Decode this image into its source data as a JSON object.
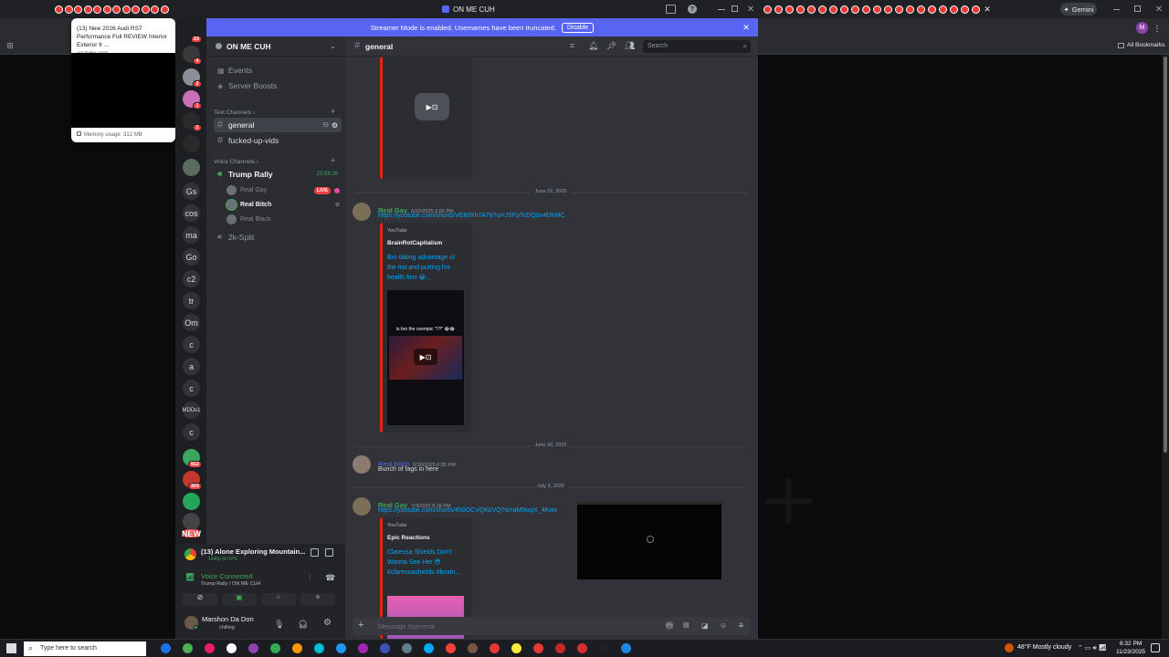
{
  "browser": {
    "window_title": "ON ME CUH",
    "gemini_label": "Gemini",
    "all_bookmarks": "All Bookmarks",
    "profile_initial": "M",
    "tab_count_left": 12,
    "tab_count_right": 20
  },
  "tooltip": {
    "title": "(13) New 2026 Audi RS7 Performance Full REVIEW Interior Exterior fr ...",
    "domain": "youtube.com",
    "memory": "Memory usage: 312 MB"
  },
  "banner": {
    "text": "Streamer Mode is enabled. Usernames have been truncated.",
    "button": "Disable"
  },
  "guilds": [
    {
      "label": "",
      "icon": "discord-home-icon",
      "badge": "23",
      "color": "#1e1f22"
    },
    {
      "label": "",
      "icon": "avatar",
      "badge": "4",
      "color": "#3a3a3a"
    },
    {
      "label": "",
      "icon": "avatar",
      "badge": "2",
      "color": "#8a8f98"
    },
    {
      "label": "",
      "icon": "avatar",
      "badge": "1",
      "color": "#c86fb5"
    },
    {
      "label": "",
      "icon": "hammers-icon",
      "badge": "1",
      "color": "#2a2a2a"
    },
    {
      "label": "",
      "icon": "mask-icon",
      "badge": "",
      "color": "#2a2a2a"
    },
    {
      "label": "",
      "icon": "avatar",
      "badge": "",
      "color": "#5b6b5f"
    },
    {
      "label": "Gs",
      "icon": "",
      "badge": "",
      "color": "#313338"
    },
    {
      "label": "cos",
      "icon": "",
      "badge": "",
      "color": "#313338"
    },
    {
      "label": "ma",
      "icon": "",
      "badge": "",
      "color": "#313338"
    },
    {
      "label": "Go",
      "icon": "",
      "badge": "",
      "color": "#313338"
    },
    {
      "label": "c2",
      "icon": "",
      "badge": "",
      "color": "#313338"
    },
    {
      "label": "tr",
      "icon": "",
      "badge": "",
      "color": "#313338"
    },
    {
      "label": "Om",
      "icon": "",
      "badge": "",
      "color": "#313338"
    },
    {
      "label": "c",
      "icon": "",
      "badge": "",
      "color": "#313338"
    },
    {
      "label": "a",
      "icon": "",
      "badge": "",
      "color": "#313338"
    },
    {
      "label": "c",
      "icon": "",
      "badge": "",
      "color": "#313338"
    },
    {
      "label": "MDDs1",
      "icon": "",
      "badge": "",
      "color": "#313338"
    },
    {
      "label": "c",
      "icon": "",
      "badge": "",
      "color": "#313338"
    },
    {
      "label": "",
      "icon": "avatar",
      "badge": "912",
      "color": "#3ba55d"
    },
    {
      "label": "",
      "icon": "avatar",
      "badge": "303",
      "color": "#c0392b"
    },
    {
      "label": "",
      "icon": "avatar",
      "badge": "",
      "color": "#23a55a"
    },
    {
      "label": "",
      "icon": "avatar",
      "badge": "",
      "color": "#444"
    },
    {
      "label": "NEW",
      "icon": "",
      "badge": "",
      "color": "#f23f43"
    }
  ],
  "server": {
    "name": "ON ME CUH",
    "events": "Events",
    "boosts": "Server Boosts",
    "text_category": "Text Channels",
    "text_channels": [
      "general",
      "fucked-up-vids"
    ],
    "voice_category": "Voice Channels",
    "voice_channel": "Trump Rally",
    "voice_timer": "25:56:26",
    "voice_users": [
      "Real Gay",
      "Real Bitch",
      "Real Black"
    ],
    "live_label": "LIVE",
    "voice_channel_2": "2k-Split"
  },
  "chat": {
    "channel": "general",
    "search_placeholder": "Search",
    "input_placeholder": "Message #general",
    "dividers": [
      "June 22, 2025",
      "June 30, 2025",
      "July 3, 2025"
    ],
    "messages": [
      {
        "author": "Real Gay",
        "time": "6/22/2025 6:56 PM",
        "link": "https://youtube.com/shorts/VEl6fXh7A78?si=JSFpTcDQ0n4fJhMC",
        "provider": "YouTube",
        "channel": "BrainRotCapitalism",
        "title": "Bro taking advantage of the riot and putting his health first 😭...",
        "thumb_caption": "is bro the ozempic \"\\?!\" 😂😂"
      },
      {
        "author": "Real Bitch",
        "time": "6/30/2025 6:05 PM",
        "text": "Bunch of fags in here"
      },
      {
        "author": "Real Gay",
        "time": "7/3/2025 9:16 PM",
        "link": "https://youtube.com/shorts/450OCVQKkVQ?si=aM0wqX_4Kwx",
        "provider": "YouTube",
        "channel": "Epic Reactions",
        "title": "Claressa Shields Don't Wanna See Her 😳 #claressashields #boxin..."
      }
    ]
  },
  "user_panel": {
    "activity_title": "(13) Alone Exploring Mountain...",
    "activity_sub": "1440p 60 FPS",
    "voice_status": "Voice Connected",
    "voice_location": "Trump Rally / ON ME CUH",
    "username": "Marshon Da Don",
    "status": "chilling"
  },
  "taskbar": {
    "search_placeholder": "Type here to search",
    "weather": "48°F  Mostly cloudy",
    "time": "6:32 PM",
    "date": "11/23/2025"
  },
  "colors": {
    "blurple": "#5865f2",
    "green": "#3ba55d",
    "link": "#00a8fc",
    "youtube_red": "#e62117"
  }
}
